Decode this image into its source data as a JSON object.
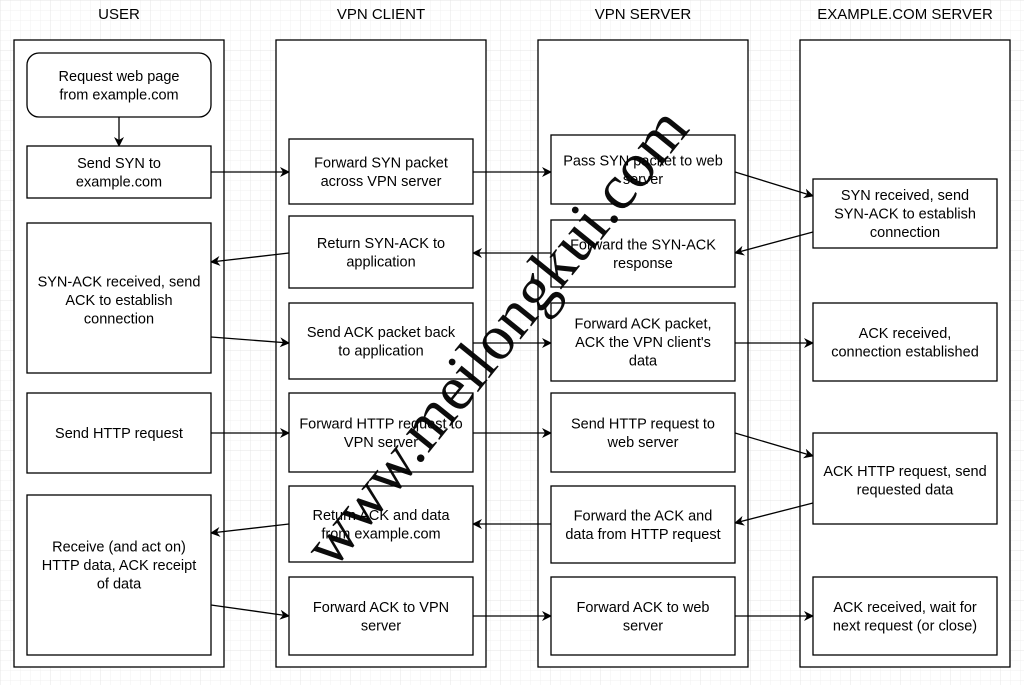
{
  "lanes": [
    {
      "id": "user",
      "title": "USER"
    },
    {
      "id": "client",
      "title": "VPN CLIENT"
    },
    {
      "id": "server",
      "title": "VPN SERVER"
    },
    {
      "id": "example",
      "title": "EXAMPLE.COM SERVER"
    }
  ],
  "steps": [
    {
      "id": "request",
      "lane": "user",
      "shape": "rounded",
      "lines": [
        "Request web page",
        "from example.com"
      ]
    },
    {
      "id": "send-syn",
      "lane": "user",
      "lines": [
        "Send SYN to",
        "example.com"
      ]
    },
    {
      "id": "synack-received",
      "lane": "user",
      "lines": [
        "SYN-ACK received, send",
        "ACK to establish",
        "connection"
      ]
    },
    {
      "id": "send-http",
      "lane": "user",
      "lines": [
        "Send HTTP request"
      ]
    },
    {
      "id": "receive-data",
      "lane": "user",
      "lines": [
        "Receive (and act on)",
        "HTTP data, ACK receipt",
        "of data"
      ]
    },
    {
      "id": "fwd-syn",
      "lane": "client",
      "lines": [
        "Forward SYN packet",
        "across VPN server"
      ]
    },
    {
      "id": "return-synack",
      "lane": "client",
      "lines": [
        "Return SYN-ACK to",
        "application"
      ]
    },
    {
      "id": "send-ack-back",
      "lane": "client",
      "lines": [
        "Send ACK packet back",
        "to application"
      ]
    },
    {
      "id": "fwd-http",
      "lane": "client",
      "lines": [
        "Forward HTTP request to",
        "VPN server"
      ]
    },
    {
      "id": "return-ack-data",
      "lane": "client",
      "lines": [
        "Return ACK and data",
        "from example.com"
      ]
    },
    {
      "id": "fwd-ack-vpn",
      "lane": "client",
      "lines": [
        "Forward ACK to VPN",
        "server"
      ]
    },
    {
      "id": "pass-syn",
      "lane": "server",
      "lines": [
        "Pass SYN packet to web",
        "server"
      ]
    },
    {
      "id": "fwd-synack",
      "lane": "server",
      "lines": [
        "Forward the SYN-ACK",
        "response"
      ]
    },
    {
      "id": "fwd-ack-packet",
      "lane": "server",
      "lines": [
        "Forward ACK packet,",
        "ACK the VPN client's",
        "data"
      ]
    },
    {
      "id": "send-http-web",
      "lane": "server",
      "lines": [
        "Send HTTP request to",
        "web server"
      ]
    },
    {
      "id": "fwd-ack-data",
      "lane": "server",
      "lines": [
        "Forward the ACK and",
        "data from HTTP request"
      ]
    },
    {
      "id": "fwd-ack-web",
      "lane": "server",
      "lines": [
        "Forward ACK to web",
        "server"
      ]
    },
    {
      "id": "syn-received",
      "lane": "example",
      "lines": [
        "SYN received, send",
        "SYN-ACK to establish",
        "connection"
      ]
    },
    {
      "id": "ack-established",
      "lane": "example",
      "lines": [
        "ACK received,",
        "connection established"
      ]
    },
    {
      "id": "ack-http",
      "lane": "example",
      "lines": [
        "ACK HTTP request, send",
        "requested data"
      ]
    },
    {
      "id": "ack-wait",
      "lane": "example",
      "lines": [
        "ACK received, wait for",
        "next request (or close)"
      ]
    }
  ],
  "flows": [
    [
      "request",
      "send-syn"
    ],
    [
      "send-syn",
      "fwd-syn"
    ],
    [
      "fwd-syn",
      "pass-syn"
    ],
    [
      "pass-syn",
      "syn-received"
    ],
    [
      "syn-received",
      "fwd-synack"
    ],
    [
      "fwd-synack",
      "return-synack"
    ],
    [
      "return-synack",
      "synack-received"
    ],
    [
      "synack-received",
      "send-ack-back"
    ],
    [
      "send-ack-back",
      "fwd-ack-packet"
    ],
    [
      "fwd-ack-packet",
      "ack-established"
    ],
    [
      "send-http",
      "fwd-http"
    ],
    [
      "fwd-http",
      "send-http-web"
    ],
    [
      "send-http-web",
      "ack-http"
    ],
    [
      "ack-http",
      "fwd-ack-data"
    ],
    [
      "fwd-ack-data",
      "return-ack-data"
    ],
    [
      "return-ack-data",
      "receive-data"
    ],
    [
      "receive-data",
      "fwd-ack-vpn"
    ],
    [
      "fwd-ack-vpn",
      "fwd-ack-web"
    ],
    [
      "fwd-ack-web",
      "ack-wait"
    ]
  ],
  "watermark": "www.meilongkui.com",
  "colors": {
    "stroke": "#000000",
    "grid": "#eeeeee",
    "background": "#ffffff"
  }
}
